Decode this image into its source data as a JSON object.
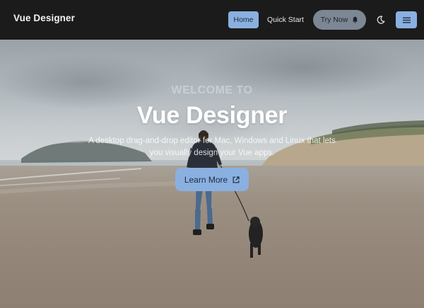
{
  "header": {
    "brand": "Vue Designer",
    "nav": {
      "home_label": "Home",
      "quick_start_label": "Quick Start",
      "try_now_label": "Try Now"
    },
    "icons": {
      "try_now": "bell-icon",
      "theme": "moon-icon",
      "menu": "hamburger-menu-icon"
    }
  },
  "hero": {
    "eyebrow": "WELCOME TO",
    "title": "Vue Designer",
    "description": "A desktop drag-and-drop editor for Mac, Windows and Linux that lets you visually design your Vue apps.",
    "cta_label": "Learn More",
    "cta_icon": "external-link-icon"
  },
  "colors": {
    "header_bg": "#1b1b1b",
    "accent": "#8ab0e0",
    "try_now_bg": "#7d8794"
  }
}
